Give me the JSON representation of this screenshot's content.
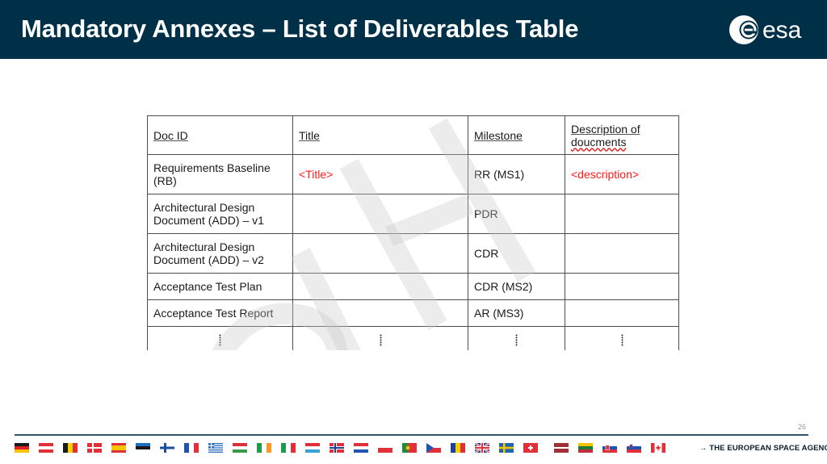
{
  "header": {
    "title": "Mandatory Annexes – List of Deliverables Table",
    "logo_text": "esa",
    "background_color": "#003047"
  },
  "table": {
    "headers": [
      "Doc ID",
      "Title",
      "Milestone",
      "Description of doucments"
    ],
    "header_lines": {
      "col4_line1": "Description of",
      "col4_line2": "doucments"
    },
    "rows": [
      {
        "doc_id_line1": "Requirements Baseline",
        "doc_id_line2": "(RB)",
        "title": "<Title>",
        "milestone": "RR (MS1)",
        "description": "<description>"
      },
      {
        "doc_id_line1": "Architectural Design",
        "doc_id_line2": "Document (ADD) – v1",
        "title": "",
        "milestone": "PDR",
        "description": ""
      },
      {
        "doc_id_line1": "Architectural Design",
        "doc_id_line2": "Document (ADD) – v2",
        "title": "",
        "milestone": "CDR",
        "description": ""
      },
      {
        "doc_id_line1": "Acceptance Test Plan",
        "doc_id_line2": "",
        "title": "",
        "milestone": "CDR (MS2)",
        "description": ""
      },
      {
        "doc_id_line1": "Acceptance Test Report",
        "doc_id_line2": "",
        "title": "",
        "milestone": "AR (MS3)",
        "description": ""
      }
    ],
    "continuation": "⋮",
    "placeholder_color": "#ff1a1a",
    "watermark_text": "DRAFT"
  },
  "footer": {
    "page_number": "26",
    "agency_tagline": "→ THE EUROPEAN SPACE AGENCY",
    "flags": [
      {
        "country": "germany"
      },
      {
        "country": "austria"
      },
      {
        "country": "belgium"
      },
      {
        "country": "denmark"
      },
      {
        "country": "spain"
      },
      {
        "country": "estonia"
      },
      {
        "country": "finland"
      },
      {
        "country": "france"
      },
      {
        "country": "greece"
      },
      {
        "country": "hungary"
      },
      {
        "country": "ireland"
      },
      {
        "country": "italy"
      },
      {
        "country": "luxembourg"
      },
      {
        "country": "norway"
      },
      {
        "country": "netherlands"
      },
      {
        "country": "poland"
      },
      {
        "country": "portugal"
      },
      {
        "country": "czech-republic"
      },
      {
        "country": "romania"
      },
      {
        "country": "united-kingdom"
      },
      {
        "country": "sweden"
      },
      {
        "country": "switzerland"
      },
      {
        "country": "latvia"
      },
      {
        "country": "lithuania"
      },
      {
        "country": "slovakia"
      },
      {
        "country": "slovenia"
      },
      {
        "country": "canada"
      }
    ]
  }
}
